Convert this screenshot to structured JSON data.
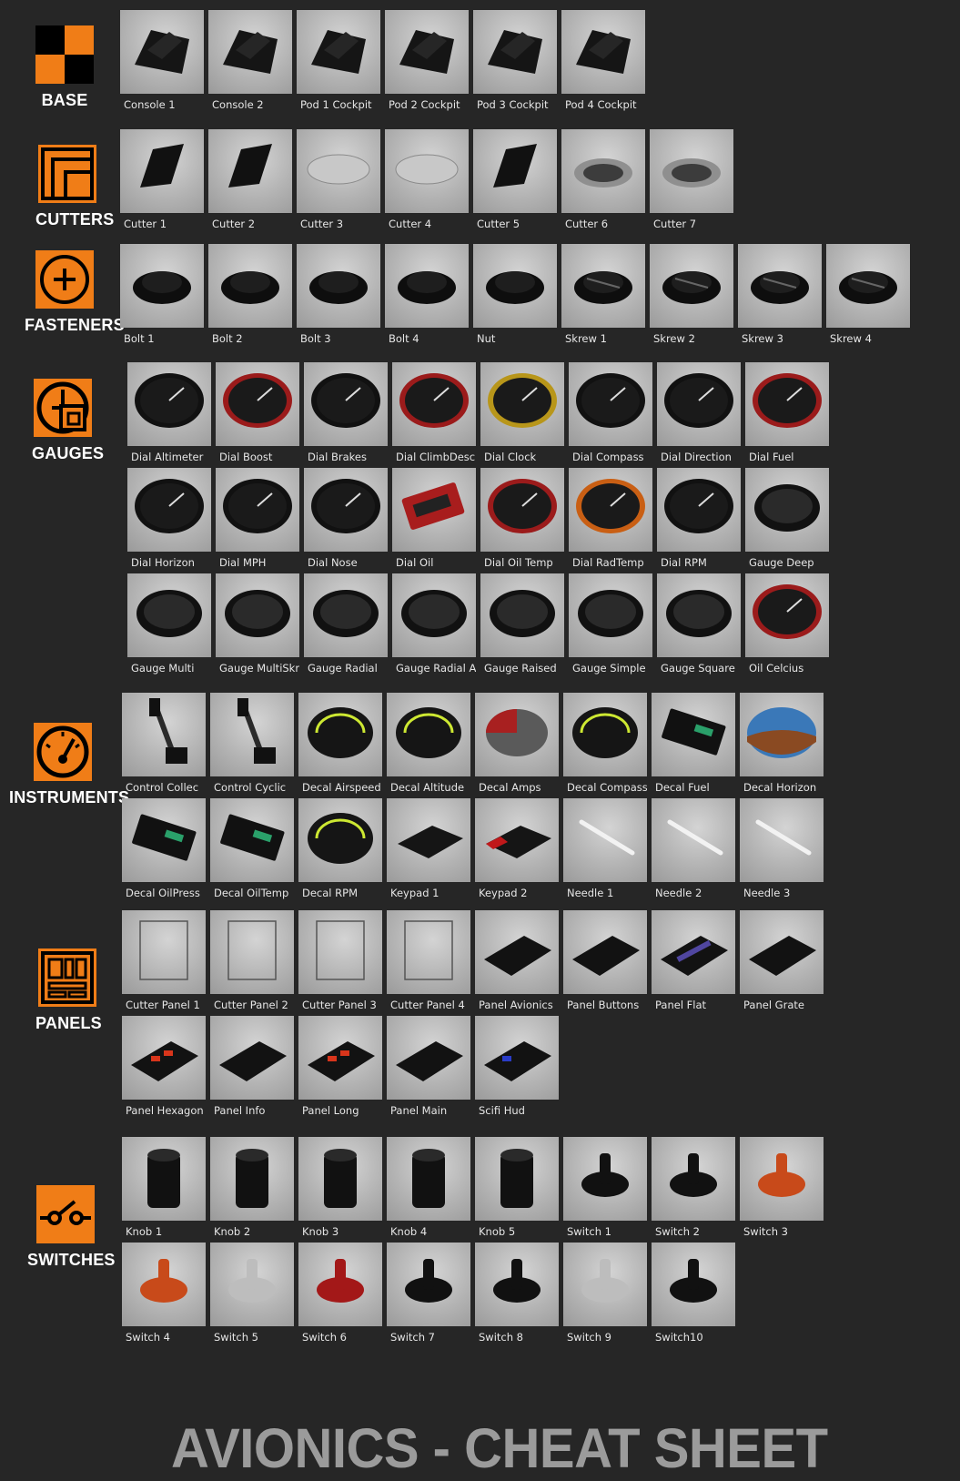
{
  "title": "AVIONICS - CHEAT SHEET",
  "accent_color": "#f07d17",
  "sections": [
    {
      "name": "BASE",
      "icon": "base-grid-icon",
      "items": [
        "Console 1",
        "Console 2",
        "Pod 1 Cockpit",
        "Pod 2 Cockpit",
        "Pod 3 Cockpit",
        "Pod 4 Cockpit"
      ]
    },
    {
      "name": "CUTTERS",
      "icon": "cutters-icon",
      "items": [
        "Cutter 1",
        "Cutter 2",
        "Cutter 3",
        "Cutter 4",
        "Cutter 5",
        "Cutter 6",
        "Cutter 7"
      ]
    },
    {
      "name": "FASTENERS",
      "icon": "fasteners-icon",
      "items": [
        "Bolt 1",
        "Bolt 2",
        "Bolt 3",
        "Bolt 4",
        "Nut",
        "Skrew 1",
        "Skrew 2",
        "Skrew 3",
        "Skrew 4"
      ]
    },
    {
      "name": "GAUGES",
      "icon": "gauges-icon",
      "items": [
        "Dial Altimeter",
        "Dial Boost",
        "Dial Brakes",
        "Dial ClimbDesc",
        "Dial Clock",
        "Dial Compass",
        "Dial Direction",
        "Dial Fuel",
        "Dial Horizon",
        "Dial MPH",
        "Dial Nose",
        "Dial Oil",
        "Dial Oil Temp",
        "Dial RadTemp",
        "Dial RPM",
        "Gauge Deep",
        "Gauge Multi",
        "Gauge MultiSkr",
        "Gauge Radial",
        "Gauge Radial A",
        "Gauge Raised",
        "Gauge Simple",
        "Gauge Square",
        "Oil Celcius"
      ]
    },
    {
      "name": "INSTRUMENTS",
      "icon": "instruments-icon",
      "items": [
        "Control Collec",
        "Control Cyclic",
        "Decal Airspeed",
        "Decal Altitude",
        "Decal Amps",
        "Decal Compass",
        "Decal Fuel",
        "Decal Horizon",
        "Decal OilPress",
        "Decal OilTemp",
        "Decal RPM",
        "Keypad 1",
        "Keypad 2",
        "Needle 1",
        "Needle 2",
        "Needle 3"
      ]
    },
    {
      "name": "PANELS",
      "icon": "panels-icon",
      "items": [
        "Cutter Panel 1",
        "Cutter Panel 2",
        "Cutter Panel 3",
        "Cutter Panel 4",
        "Panel Avionics",
        "Panel Buttons",
        "Panel Flat",
        "Panel Grate",
        "Panel Hexagon",
        "Panel Info",
        "Panel Long",
        "Panel Main",
        "Scifi Hud"
      ]
    },
    {
      "name": "SWITCHES",
      "icon": "switches-icon",
      "items": [
        "Knob 1",
        "Knob 2",
        "Knob 3",
        "Knob 4",
        "Knob 5",
        "Switch 1",
        "Switch 2",
        "Switch 3",
        "Switch 4",
        "Switch 5",
        "Switch 6",
        "Switch 7",
        "Switch 8",
        "Switch 9",
        "Switch10"
      ]
    }
  ]
}
